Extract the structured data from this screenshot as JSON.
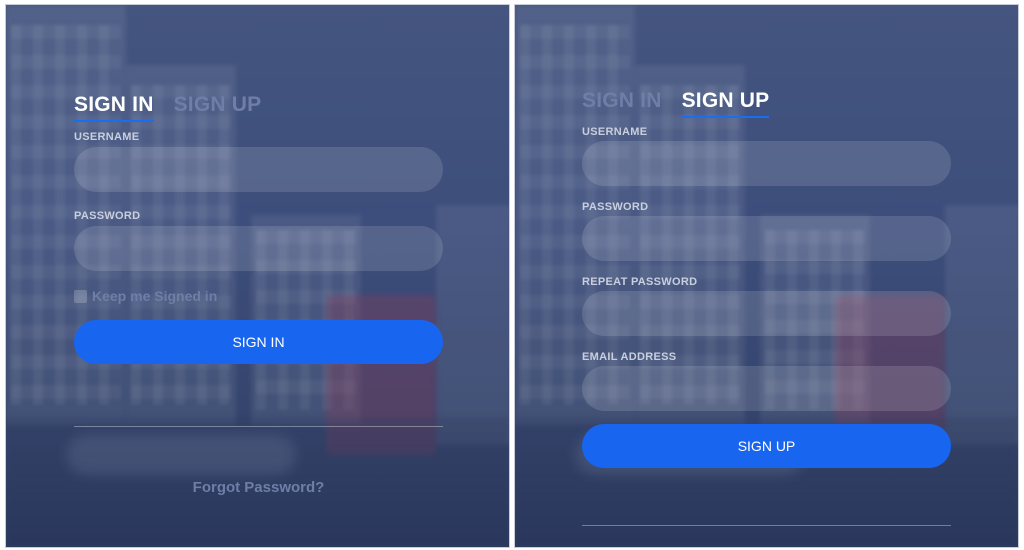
{
  "signin_panel": {
    "tabs": [
      {
        "label": "SIGN IN",
        "active": true
      },
      {
        "label": "SIGN UP",
        "active": false
      }
    ],
    "username_label": "USERNAME",
    "username_value": "",
    "password_label": "PASSWORD",
    "password_value": "",
    "keep_signed_in_label": "Keep me Signed in",
    "keep_signed_in_checked": false,
    "submit_label": "SIGN IN",
    "forgot_label": "Forgot Password?"
  },
  "signup_panel": {
    "tabs": [
      {
        "label": "SIGN IN",
        "active": false
      },
      {
        "label": "SIGN UP",
        "active": true
      }
    ],
    "username_label": "USERNAME",
    "username_value": "",
    "password_label": "PASSWORD",
    "password_value": "",
    "repeat_password_label": "REPEAT PASSWORD",
    "repeat_password_value": "",
    "email_label": "EMAIL ADDRESS",
    "email_value": "",
    "submit_label": "SIGN UP"
  },
  "colors": {
    "panel_background": "#3b4d7f",
    "accent": "#1866ef",
    "active_tab_text": "#ffffff",
    "inactive_tab_text": "#6f7ea6"
  },
  "icons": {
    "checkbox": "checkbox-icon"
  }
}
